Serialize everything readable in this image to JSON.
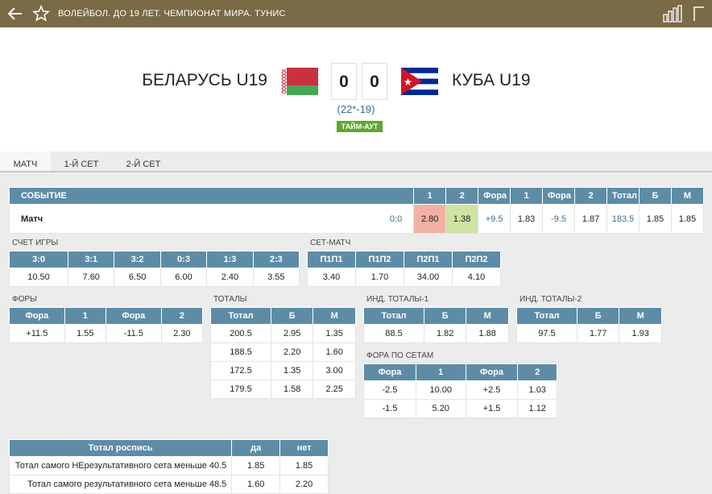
{
  "header": {
    "title": "ВОЛЕЙБОЛ. ДО 19 ЛЕТ. ЧЕМПИОНАТ МИРА. ТУНИС"
  },
  "match": {
    "team1": "БЕЛАРУСЬ U19",
    "team2": "КУБА U19",
    "score1": "0",
    "score2": "0",
    "sets": "(22*-19)",
    "status": "ТАЙМ-АУТ"
  },
  "tabs": [
    "МАТЧ",
    "1-Й СЕТ",
    "2-Й СЕТ"
  ],
  "main": {
    "headers": [
      "СОБЫТИЕ",
      "1",
      "2",
      "Фора",
      "1",
      "Фора",
      "2",
      "Тотал",
      "Б",
      "М"
    ],
    "row": {
      "name": "Матч",
      "score": "0:0",
      "c1": "2.80",
      "c2": "1.38",
      "h1": "+9.5",
      "h1o": "1.83",
      "h2": "-9.5",
      "h2o": "1.87",
      "tot": "183.5",
      "over": "1.85",
      "under": "1.85"
    }
  },
  "score_game": {
    "title": "СЧЕТ ИГРЫ",
    "headers": [
      "3:0",
      "3:1",
      "3:2",
      "0:3",
      "1:3",
      "2:3"
    ],
    "values": [
      "10.50",
      "7.60",
      "6.50",
      "6.00",
      "2.40",
      "3.55"
    ]
  },
  "set_match": {
    "title": "СЕТ-МАТЧ",
    "headers": [
      "П1П1",
      "П1П2",
      "П2П1",
      "П2П2"
    ],
    "values": [
      "3.40",
      "1.70",
      "34.00",
      "4.10"
    ]
  },
  "handicaps": {
    "title": "ФОРЫ",
    "headers": [
      "Фора",
      "1",
      "Фора",
      "2"
    ],
    "rows": [
      [
        "+11.5",
        "1.55",
        "-11.5",
        "2.30"
      ]
    ]
  },
  "totals": {
    "title": "ТОТАЛЫ",
    "headers": [
      "Тотал",
      "Б",
      "М"
    ],
    "rows": [
      [
        "200.5",
        "2.95",
        "1.35"
      ],
      [
        "188.5",
        "2.20",
        "1.60"
      ],
      [
        "172.5",
        "1.35",
        "3.00"
      ],
      [
        "179.5",
        "1.58",
        "2.25"
      ]
    ]
  },
  "ind_totals_1": {
    "title": "ИНД. ТОТАЛЫ-1",
    "headers": [
      "Тотал",
      "Б",
      "М"
    ],
    "rows": [
      [
        "88.5",
        "1.82",
        "1.88"
      ]
    ]
  },
  "ind_totals_2": {
    "title": "ИНД. ТОТАЛЫ-2",
    "headers": [
      "Тотал",
      "Б",
      "М"
    ],
    "rows": [
      [
        "97.5",
        "1.77",
        "1.93"
      ]
    ]
  },
  "set_handicaps": {
    "title": "ФОРА ПО СЕТАМ",
    "headers": [
      "Фора",
      "1",
      "Фора",
      "2"
    ],
    "rows": [
      [
        "-2.5",
        "10.00",
        "+2.5",
        "1.03"
      ],
      [
        "-1.5",
        "5.20",
        "+1.5",
        "1.12"
      ]
    ]
  },
  "total_list": {
    "headers": [
      "Тотал роспись",
      "да",
      "нет"
    ],
    "rows": [
      [
        "Тотал самого НЕрезультативного сета меньше 40.5",
        "1.85",
        "1.85"
      ],
      [
        "Тотал самого результативного сета меньше 48.5",
        "1.60",
        "2.20"
      ]
    ]
  },
  "colors": {
    "topbar": "#7a6a45",
    "table_header": "#5e8ca7",
    "timeout": "#5ea82b",
    "odd_red": "#f2b1a4",
    "odd_green": "#cfe3a3"
  },
  "icons": {
    "back": "arrow-left-icon",
    "favorite": "star-outline-icon",
    "stats": "bar-chart-icon"
  }
}
